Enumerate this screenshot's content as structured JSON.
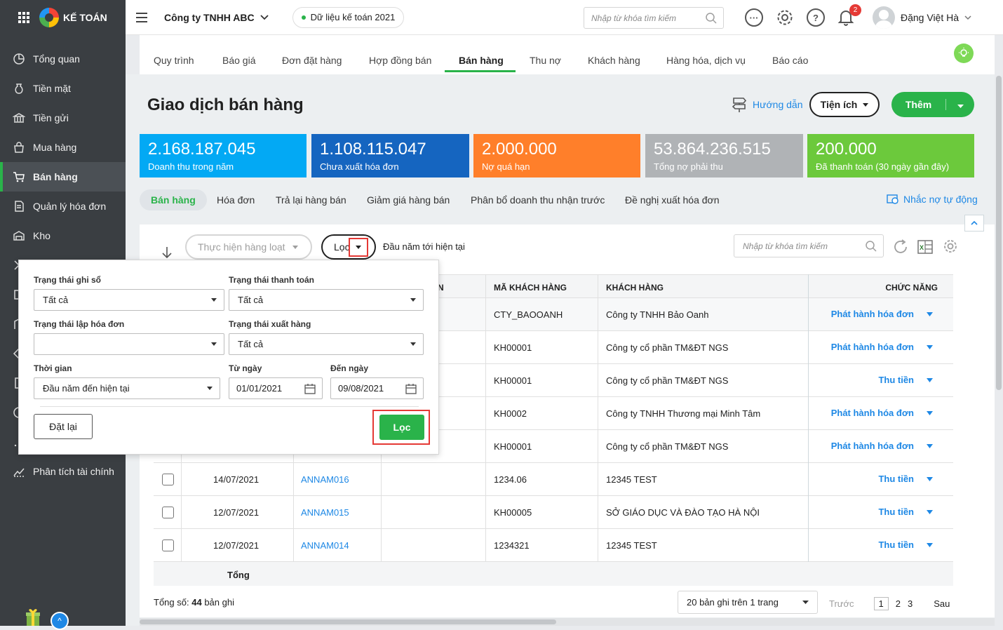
{
  "sidebar": {
    "brand": "KẾ TOÁN",
    "items": [
      {
        "label": "Tổng quan",
        "icon": "chart-icon"
      },
      {
        "label": "Tiền mặt",
        "icon": "cash-icon"
      },
      {
        "label": "Tiền gửi",
        "icon": "bank-icon"
      },
      {
        "label": "Mua hàng",
        "icon": "shopping-bag-icon"
      },
      {
        "label": "Bán hàng",
        "icon": "cart-icon"
      },
      {
        "label": "Quản lý hóa đơn",
        "icon": "invoice-icon"
      },
      {
        "label": "Kho",
        "icon": "warehouse-icon"
      },
      {
        "label": "Phân tích tài chính",
        "icon": "analytics-icon"
      }
    ],
    "active_index": 4
  },
  "topbar": {
    "company": "Công ty TNHH ABC",
    "data_set": "Dữ liệu kế toán 2021",
    "search_placeholder": "Nhập từ khóa tìm kiếm",
    "notification_count": "2",
    "user_name": "Đặng Việt Hà"
  },
  "main_tabs": [
    "Quy trình",
    "Báo giá",
    "Đơn đặt hàng",
    "Hợp đồng bán",
    "Bán hàng",
    "Thu nợ",
    "Khách hàng",
    "Hàng hóa, dịch vụ",
    "Báo cáo"
  ],
  "page": {
    "title": "Giao dịch bán hàng",
    "guide": "Hướng dẫn",
    "utility_button": "Tiện ích",
    "add_button": "Thêm"
  },
  "stats": [
    {
      "value": "2.168.187.045",
      "label": "Doanh thu trong năm",
      "color": "#03a9f4"
    },
    {
      "value": "1.108.115.047",
      "label": "Chưa xuất hóa đơn",
      "color": "#1565c0"
    },
    {
      "value": "2.000.000",
      "label": "Nợ quá hạn",
      "color": "#ff7f2a"
    },
    {
      "value": "53.864.236.515",
      "label": "Tổng nợ phải thu",
      "color": "#b0b3b6"
    },
    {
      "value": "200.000",
      "label": "Đã thanh toán (30 ngày gần đây)",
      "color": "#6cc93c"
    }
  ],
  "sub_tabs": [
    "Bán hàng",
    "Hóa đơn",
    "Trả lại hàng bán",
    "Giảm giá hàng bán",
    "Phân bổ doanh thu nhận trước",
    "Đề nghị xuất hóa đơn"
  ],
  "auto_remind": "Nhắc nợ tự động",
  "toolbar": {
    "batch": "Thực hiện hàng loạt",
    "filter": "Lọc",
    "period": "Đầu năm tới hiện tại",
    "search_placeholder": "Nhập từ khóa tìm kiếm"
  },
  "table": {
    "headers": {
      "col_partial": "N",
      "customer_code": "MÃ KHÁCH HÀNG",
      "customer": "KHÁCH HÀNG",
      "action": "CHỨC NĂNG"
    },
    "rows": [
      {
        "date": "",
        "doc": "",
        "code": "CTY_BAOOANH",
        "customer": "Công ty TNHH Bảo Oanh",
        "action": "Phát hành hóa đơn"
      },
      {
        "date": "",
        "doc": "",
        "code": "KH00001",
        "customer": "Công ty cổ phần TM&ĐT NGS",
        "action": "Phát hành hóa đơn"
      },
      {
        "date": "",
        "doc": "",
        "code": "KH00001",
        "customer": "Công ty cổ phần TM&ĐT NGS",
        "action": "Thu tiền"
      },
      {
        "date": "",
        "doc": "",
        "code": "KH0002",
        "customer": "Công ty TNHH Thương mại Minh Tâm",
        "action": "Phát hành hóa đơn"
      },
      {
        "date": "",
        "doc": "",
        "code": "KH00001",
        "customer": "Công ty cổ phần TM&ĐT NGS",
        "action": "Phát hành hóa đơn"
      },
      {
        "date": "14/07/2021",
        "doc": "ANNAM016",
        "code": "1234.06",
        "customer": "12345 TEST",
        "action": "Thu tiền"
      },
      {
        "date": "12/07/2021",
        "doc": "ANNAM015",
        "code": "KH00005",
        "customer": "SỞ GIÁO DỤC VÀ ĐÀO TẠO HÀ NỘI",
        "action": "Thu tiền"
      },
      {
        "date": "12/07/2021",
        "doc": "ANNAM014",
        "code": "1234321",
        "customer": "12345 TEST",
        "action": "Thu tiền"
      }
    ],
    "total_label": "Tổng"
  },
  "footer": {
    "total_prefix": "Tổng số:",
    "total_count": "44",
    "total_suffix": "bản ghi",
    "per_page": "20 bản ghi trên 1 trang",
    "prev": "Trước",
    "pages": [
      "1",
      "2",
      "3"
    ],
    "next": "Sau"
  },
  "filter_popup": {
    "ledger_status_label": "Trạng thái ghi sổ",
    "ledger_status_value": "Tất cả",
    "payment_status_label": "Trạng thái thanh toán",
    "payment_status_value": "Tất cả",
    "invoice_status_label": "Trạng thái lập hóa đơn",
    "invoice_status_value": "",
    "delivery_status_label": "Trạng thái xuất hàng",
    "delivery_status_value": "Tất cả",
    "time_label": "Thời gian",
    "time_value": "Đầu năm đến hiện tại",
    "from_label": "Từ ngày",
    "from_value": "01/01/2021",
    "to_label": "Đến ngày",
    "to_value": "09/08/2021",
    "reset": "Đặt lại",
    "apply": "Lọc"
  }
}
